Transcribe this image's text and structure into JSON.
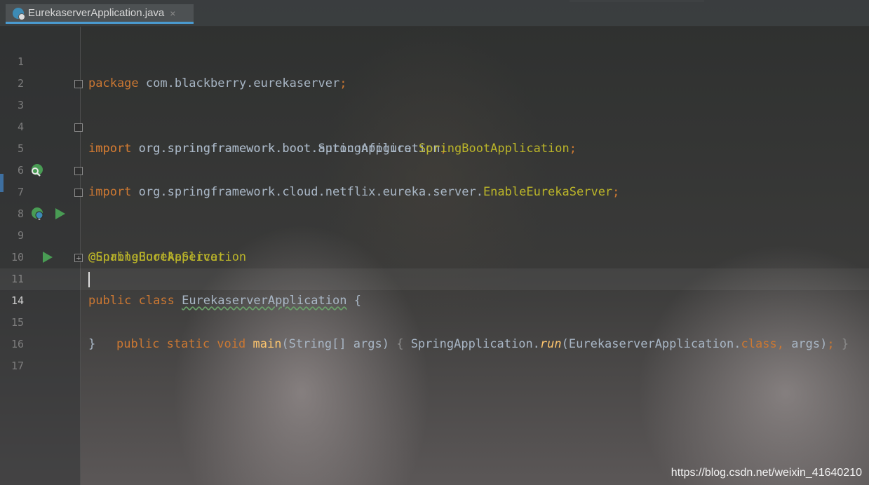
{
  "tab": {
    "label": "EurekaserverApplication.java",
    "close_glyph": "×",
    "icon": "spring-class-icon"
  },
  "lines": {
    "l1": {
      "num": "1",
      "kw": "package",
      "rest": " com.blackberry.eurekaserver",
      "semi": ";"
    },
    "l2": {
      "num": "2"
    },
    "l3": {
      "num": "3",
      "kw": "import",
      "rest": " org.springframework.boot.SpringApplication",
      "semi": ";"
    },
    "l4": {
      "num": "4",
      "kw": "import",
      "rest": " org.springframework.boot.autoconfigure.",
      "hl": "SpringBootApplication",
      "semi": ";"
    },
    "l5": {
      "num": "5",
      "kw": "import",
      "rest": " org.springframework.cloud.netflix.eureka.server.",
      "hl": "EnableEurekaServer",
      "semi": ";"
    },
    "l6": {
      "num": "6"
    },
    "l7": {
      "num": "7",
      "ann": "@SpringBootApplication"
    },
    "l8": {
      "num": "8",
      "ann": "@EnableEurekaServer"
    },
    "l9": {
      "num": "9",
      "kw": "public class",
      "cls": "EurekaserverApplication",
      "rest": " {"
    },
    "l10": {
      "num": "10"
    },
    "l11": {
      "num": "11",
      "kw1": "public static void",
      "fn": "main",
      "args": "(String[] args) ",
      "brace_open": "{",
      "call": " SpringApplication.",
      "run": "run",
      "call_args": "(EurekaserverApplication.",
      "kw2": "class",
      "comma": ",",
      "tail": " args)",
      "semi": ";",
      "brace_close": " }"
    },
    "l14": {
      "num": "14"
    },
    "l15": {
      "num": "15",
      "text": "}"
    },
    "l16": {
      "num": "16"
    },
    "l17": {
      "num": "17"
    }
  },
  "gutter_icons": {
    "line7": "spring-bean-search-icon",
    "line9": "spring-bean-run-icon",
    "line9_run": "run-triangle-icon",
    "line11_run": "run-triangle-icon"
  },
  "colors": {
    "background": "#2b2b2b",
    "keyword": "#cc7832",
    "annotation": "#bbb529",
    "method": "#ffc66d",
    "text": "#a9b7c6",
    "tab_accent": "#4a9bd0",
    "run_green": "#499c54"
  },
  "watermark": "https://blog.csdn.net/weixin_41640210"
}
